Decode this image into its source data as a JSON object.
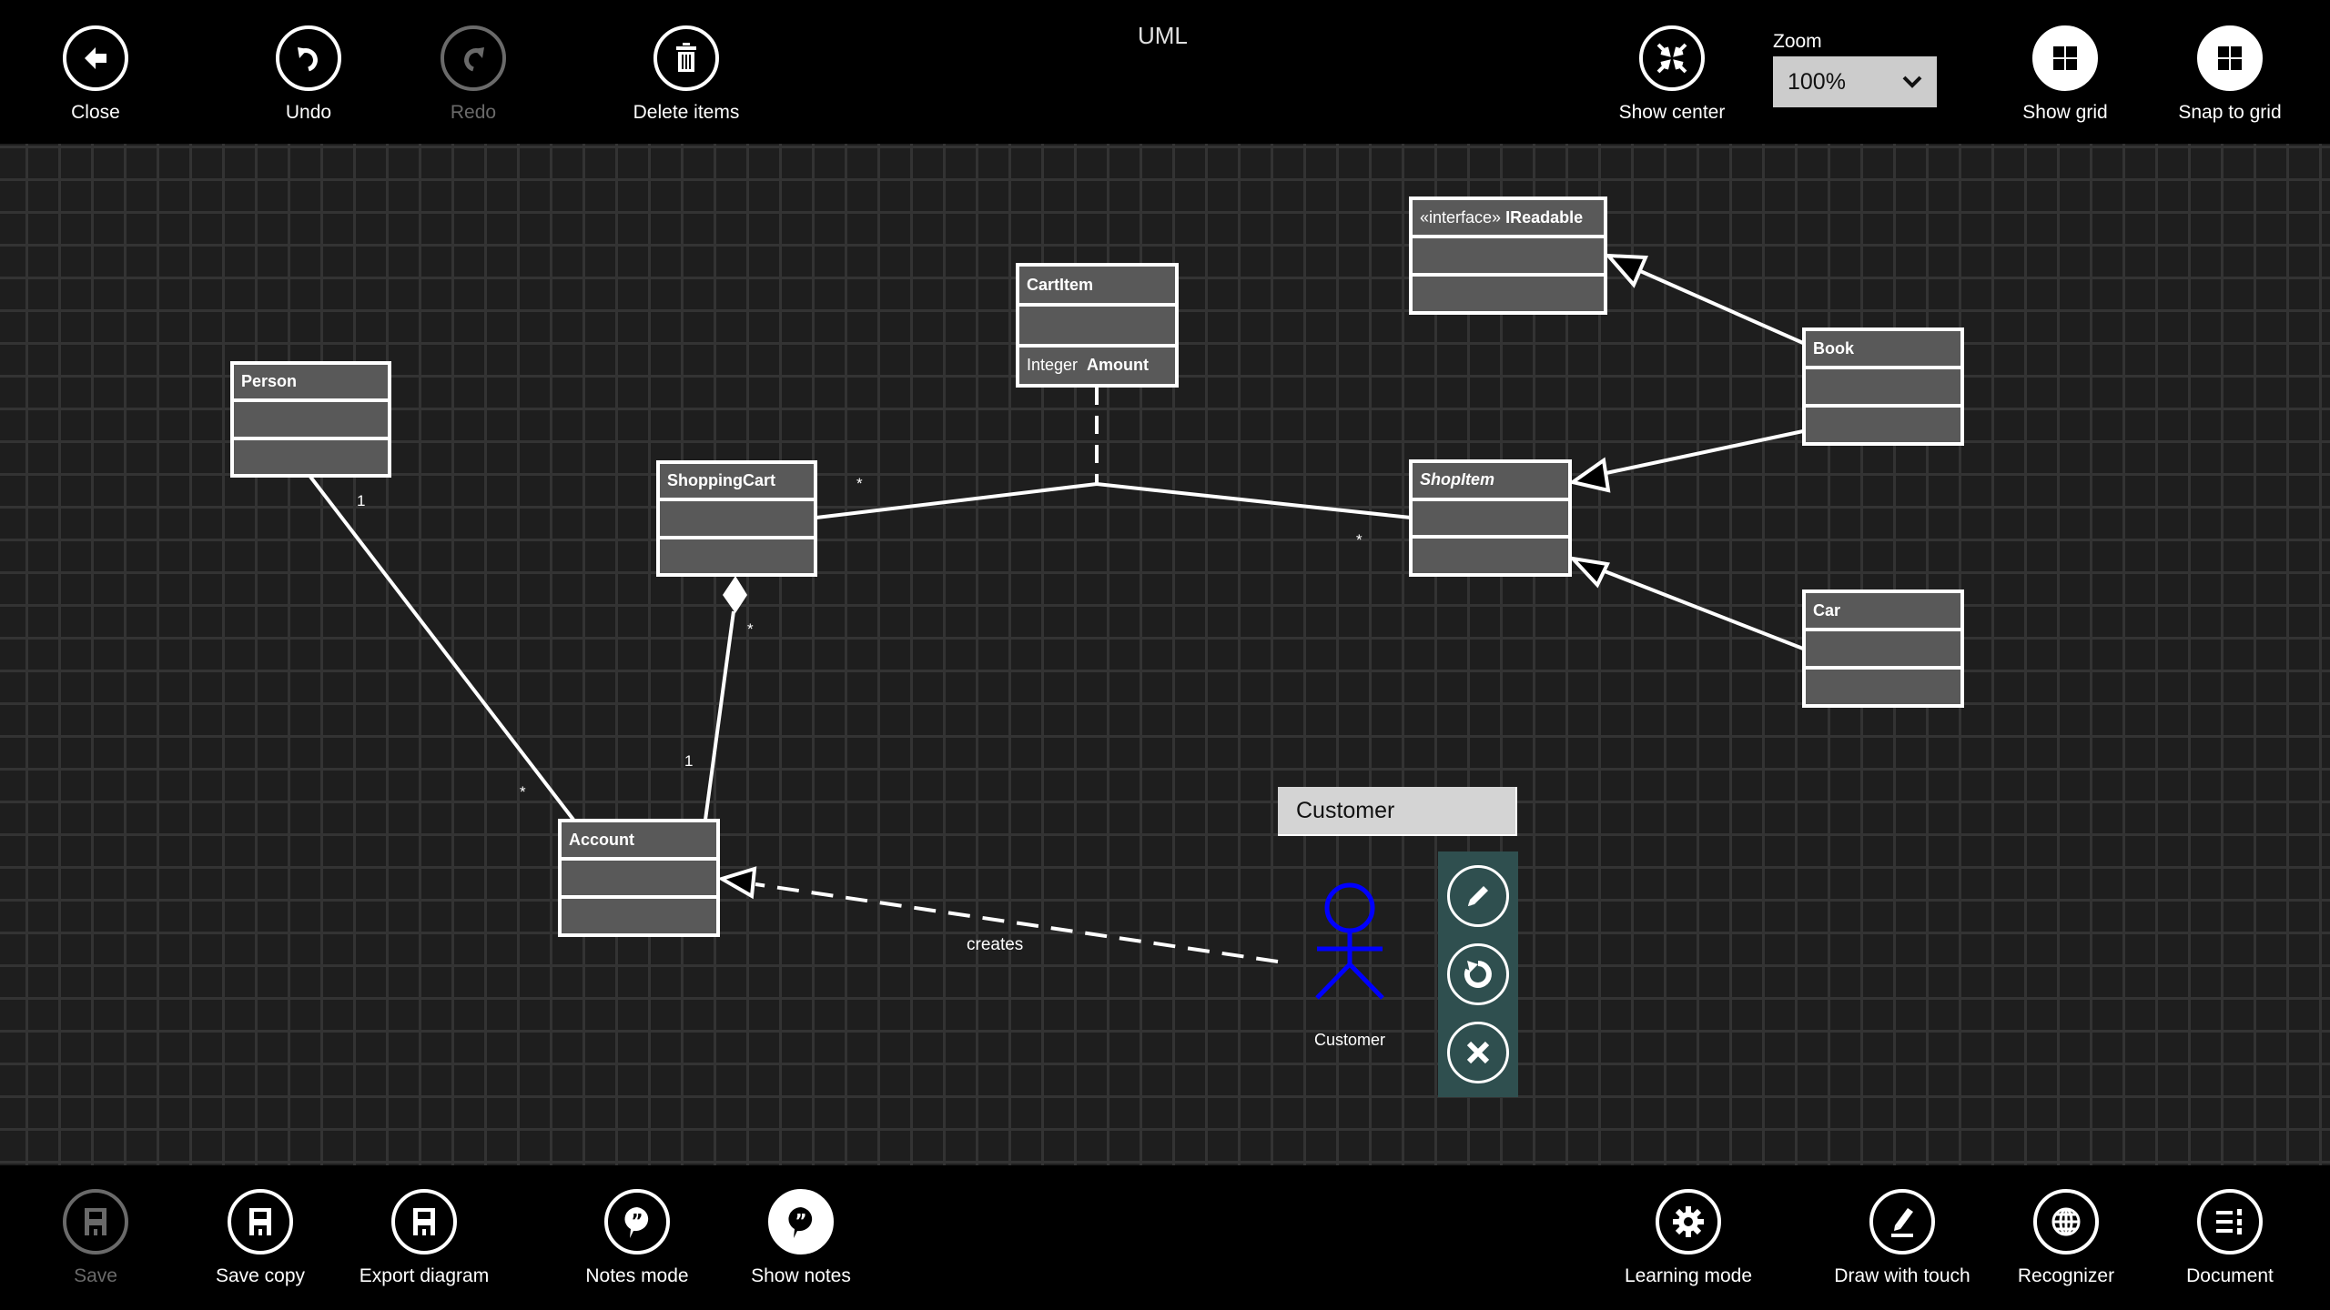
{
  "app": {
    "title": "UML"
  },
  "top_toolbar": {
    "close": "Close",
    "undo": "Undo",
    "redo": "Redo",
    "delete_items": "Delete items",
    "show_center": "Show center",
    "zoom_label": "Zoom",
    "zoom_value": "100%",
    "show_grid": "Show grid",
    "snap_to_grid": "Snap to grid"
  },
  "bottom_toolbar": {
    "save": "Save",
    "save_copy": "Save copy",
    "export_diagram": "Export diagram",
    "notes_mode": "Notes mode",
    "show_notes": "Show notes",
    "learning_mode": "Learning mode",
    "draw_with_touch": "Draw with touch",
    "recognizer": "Recognizer",
    "document": "Document"
  },
  "diagram": {
    "classes": {
      "person": {
        "name": "Person"
      },
      "shopping_cart": {
        "name": "ShoppingCart"
      },
      "cart_item": {
        "name": "CartItem",
        "attr_type": "Integer",
        "attr_name": "Amount"
      },
      "ireadable": {
        "stereotype": "«interface»",
        "name": "IReadable"
      },
      "book": {
        "name": "Book"
      },
      "shop_item": {
        "name": "ShopItem"
      },
      "car": {
        "name": "Car"
      },
      "account": {
        "name": "Account"
      }
    },
    "multiplicities": {
      "person_account_person_end": "1",
      "person_account_account_end": "*",
      "cart_account_cart_end": "*",
      "cart_account_account_end": "1",
      "cart_shopitem_cart_end": "*",
      "cart_shopitem_item_end": "*"
    },
    "relation_labels": {
      "creates": "creates"
    },
    "actor": {
      "name": "Customer",
      "color": "#0000ff"
    },
    "name_editor": {
      "value": "Customer"
    },
    "action_panel_color": "#2f4f4f"
  }
}
